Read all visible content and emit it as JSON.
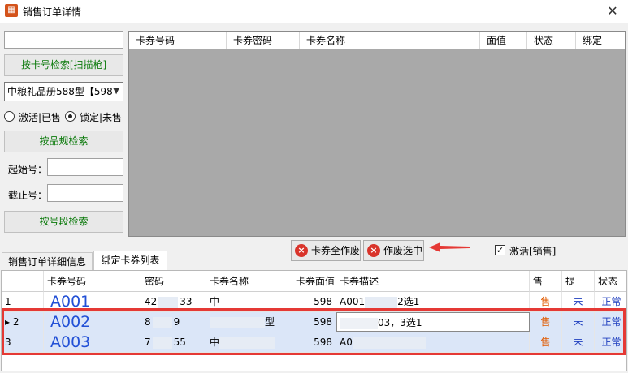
{
  "window": {
    "title": "销售订单详情",
    "close_glyph": "✕"
  },
  "left": {
    "search_value": "",
    "search_button": "按卡号检索[扫描枪]",
    "product_select": "中粮礼品册588型【598",
    "radio_activated": "激活|已售",
    "radio_locked": "锁定|未售",
    "spec_button": "按品规检索",
    "start_label": "起始号：",
    "start_value": "",
    "end_label": "截止号：",
    "end_value": "",
    "range_button": "按号段检索"
  },
  "top_grid": {
    "headers": [
      "卡券号码",
      "卡券密码",
      "卡券名称",
      "面值",
      "状态",
      "绑定"
    ]
  },
  "tabs": [
    "销售订单详细信息",
    "绑定卡券列表"
  ],
  "actions": {
    "void_all": "卡券全作废",
    "void_selected": "作废选中",
    "activate_label": "激活[销售]",
    "activate_checked": "✓"
  },
  "bottom_grid": {
    "headers": [
      "卡券号码",
      "密码",
      "卡券名称",
      "卡券面值",
      "卡券描述",
      "售",
      "提",
      "状态"
    ],
    "rows": [
      {
        "idx": "1",
        "marker": "",
        "code": "A001",
        "pwd_a": "42",
        "pwd_b": "33",
        "name": "中",
        "value": "598",
        "desc": "A001",
        "desc_b": "2选1",
        "sold": "售",
        "picked": "未",
        "status": "正常"
      },
      {
        "idx": "2",
        "marker": "▸",
        "code": "A002",
        "pwd_a": "8",
        "pwd_b": "9",
        "name": "型",
        "value": "598",
        "desc": "",
        "desc_b": "03，3选1",
        "sold": "售",
        "picked": "未",
        "status": "正常"
      },
      {
        "idx": "3",
        "marker": "",
        "code": "A003",
        "pwd_a": "7",
        "pwd_b": "55",
        "name": "中",
        "value": "598",
        "desc": "A0",
        "desc_b": "",
        "sold": "售",
        "picked": "未",
        "status": "正常"
      }
    ]
  },
  "colors": {
    "accent_red": "#e53935",
    "grid_gray": "#a9a9a9",
    "code_blue": "#2250d6"
  }
}
